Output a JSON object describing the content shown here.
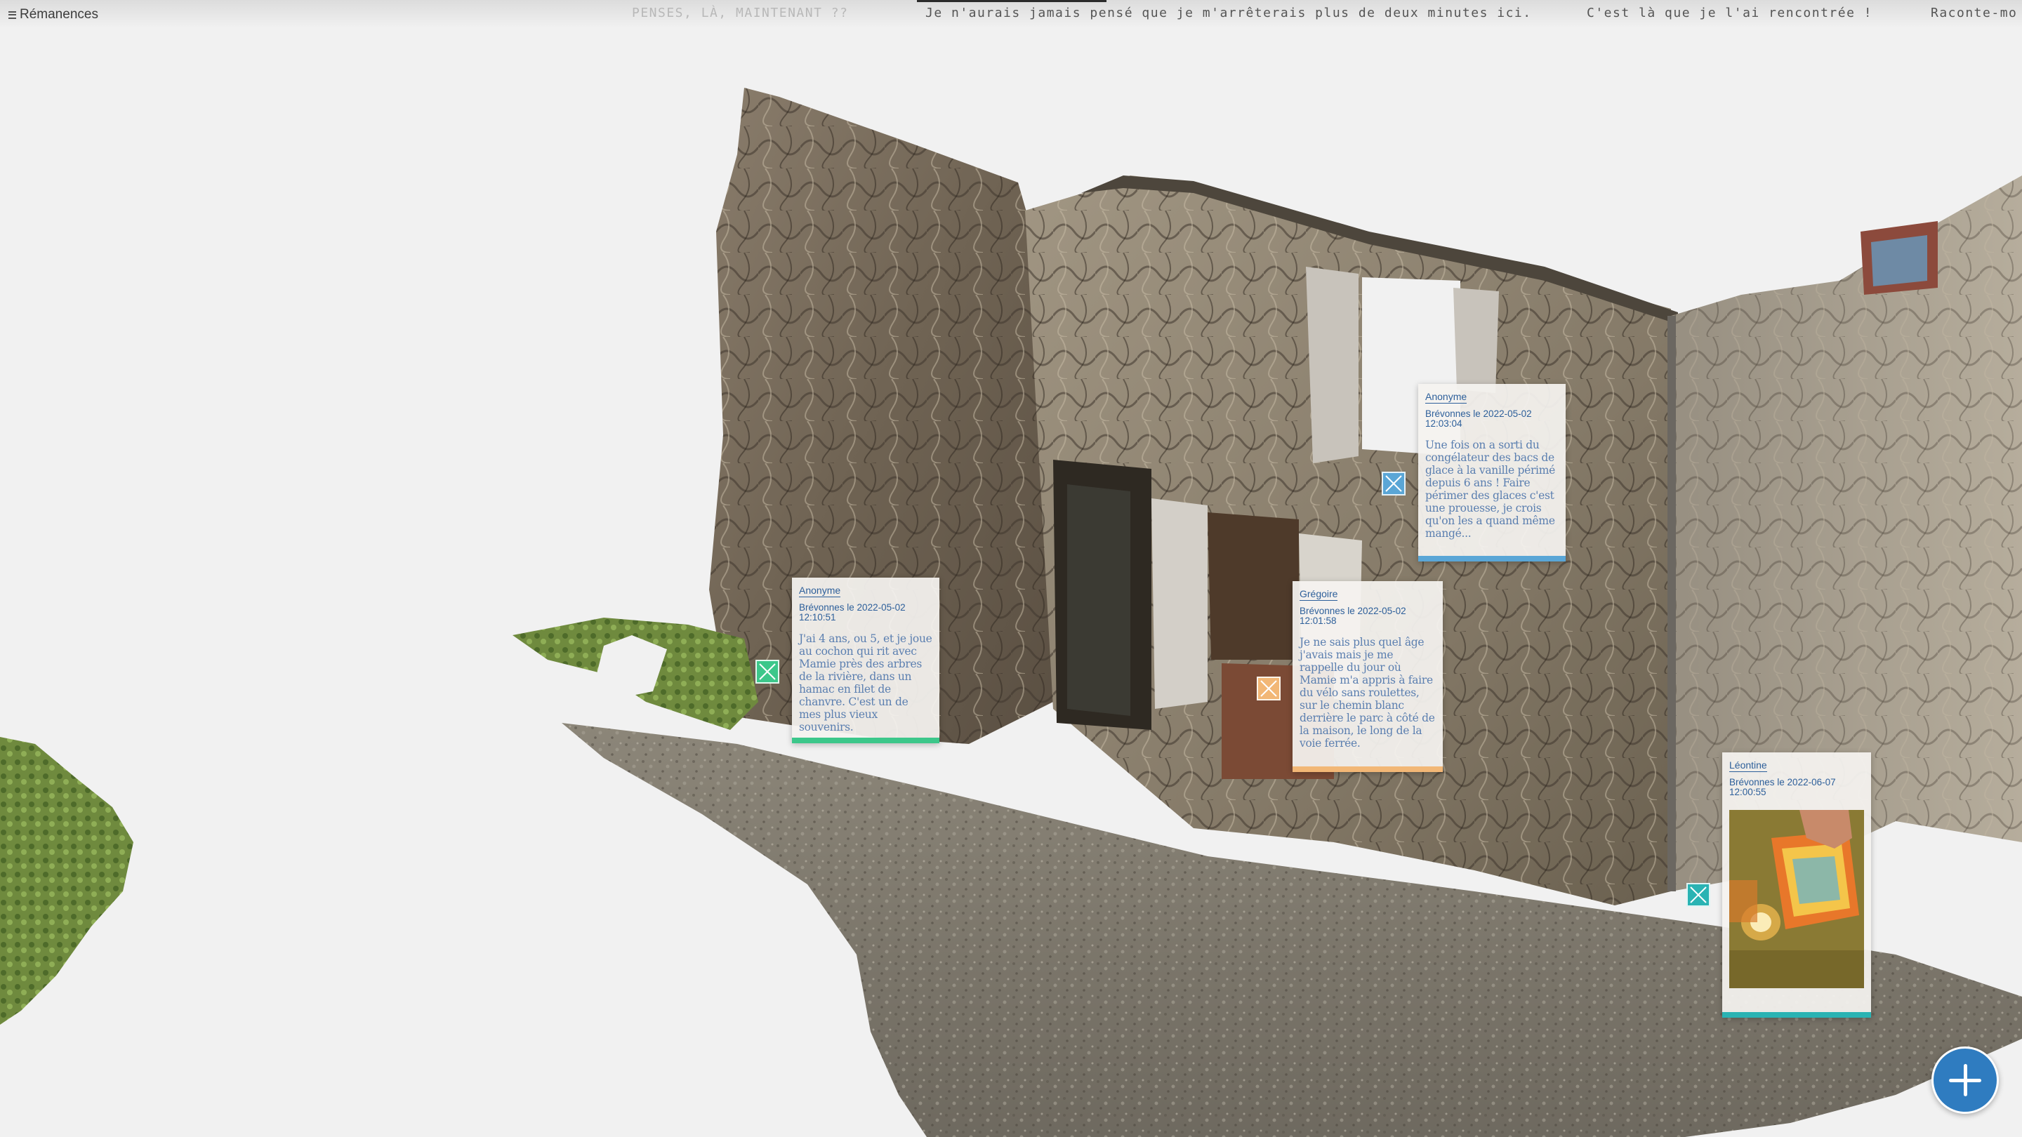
{
  "app": {
    "title": "Rémanences",
    "menu_icon": "hamburger-icon"
  },
  "ticker": [
    {
      "text": "PENSES, LÀ, MAINTENANT ??",
      "faded": true
    },
    {
      "text": "Je n'aurais jamais pensé que je m'arrêterais plus de deux minutes ici.",
      "faded": false
    },
    {
      "text": "C'est là que je l'ai rencontrée !",
      "faded": false
    },
    {
      "text": "Raconte-mo",
      "faded": false
    }
  ],
  "cards": [
    {
      "author": "Anonyme",
      "place_date": "Brévonnes le 2022-05-02",
      "time": "12:10:51",
      "text": "J'ai 4 ans, ou 5, et je joue au cochon qui rit avec Mamie près des arbres de la rivière, dans un hamac en filet de chanvre. C'est un de mes plus vieux souvenirs.",
      "accent": "#3cc78a"
    },
    {
      "author": "Anonyme",
      "place_date": "Brévonnes le 2022-05-02",
      "time": "12:03:04",
      "text": "Une fois on a sorti du congélateur des bacs de glace à la vanille périmé depuis 6 ans ! Faire périmer des glaces c'est une prouesse, je crois qu'on les a quand même mangé...",
      "accent": "#5aa6d6"
    },
    {
      "author": "Grégoire",
      "place_date": "Brévonnes le 2022-05-02",
      "time": "12:01:58",
      "text": "Je ne sais plus quel âge j'avais mais je me rappelle du jour où Mamie m'a appris à faire du vélo sans roulettes, sur le chemin blanc derrière le parc à côté de la maison, le long de la voie ferrée.",
      "accent": "#f2b776"
    },
    {
      "author": "Léontine",
      "place_date": "Brévonnes le 2022-06-07",
      "time": "12:00:55",
      "text": "",
      "accent": "#2ab3b3",
      "has_photo": true
    }
  ],
  "markers": [
    {
      "color": "#3cc78a"
    },
    {
      "color": "#5aa6d6"
    },
    {
      "color": "#f2b776"
    },
    {
      "color": "#2ab3b3"
    }
  ],
  "add_button": {
    "icon": "plus-icon",
    "color": "#2f7cc0"
  }
}
